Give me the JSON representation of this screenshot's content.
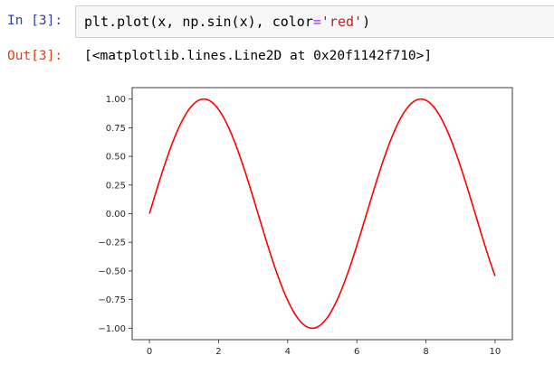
{
  "input_cell": {
    "prompt": "In [3]:",
    "code": {
      "prefix": "plt.plot(x, np.sin(x), color",
      "equals": "=",
      "string": "'red'",
      "suffix": ")"
    }
  },
  "output_cell": {
    "prompt": "Out[3]:",
    "text": "[<matplotlib.lines.Line2D at 0x20f1142f710>]"
  },
  "chart_data": {
    "type": "line",
    "function": "sin(x)",
    "x_range": [
      0,
      10
    ],
    "series": [
      {
        "color": "#ff0000",
        "x": [
          0,
          0.5,
          1,
          1.5,
          1.5708,
          2,
          2.5,
          3,
          3.5,
          4,
          4.5,
          4.7124,
          5,
          5.5,
          6,
          6.5,
          7,
          7.5,
          7.854,
          8,
          8.5,
          9,
          9.5,
          10
        ],
        "y": [
          0,
          0.479,
          0.841,
          0.997,
          1.0,
          0.909,
          0.598,
          0.141,
          -0.351,
          -0.757,
          -0.978,
          -1.0,
          -0.959,
          -0.706,
          -0.279,
          0.215,
          0.657,
          0.938,
          1.0,
          0.989,
          0.798,
          0.412,
          -0.075,
          -0.544
        ]
      }
    ],
    "xlim": [
      -0.5,
      10.5
    ],
    "ylim": [
      -1.1,
      1.1
    ],
    "xticks": [
      "0",
      "2",
      "4",
      "6",
      "8",
      "10"
    ],
    "yticks": [
      "1.00",
      "0.75",
      "0.50",
      "0.25",
      "0.00",
      "−0.25",
      "−0.50",
      "−0.75",
      "−1.00"
    ],
    "grid": false
  }
}
